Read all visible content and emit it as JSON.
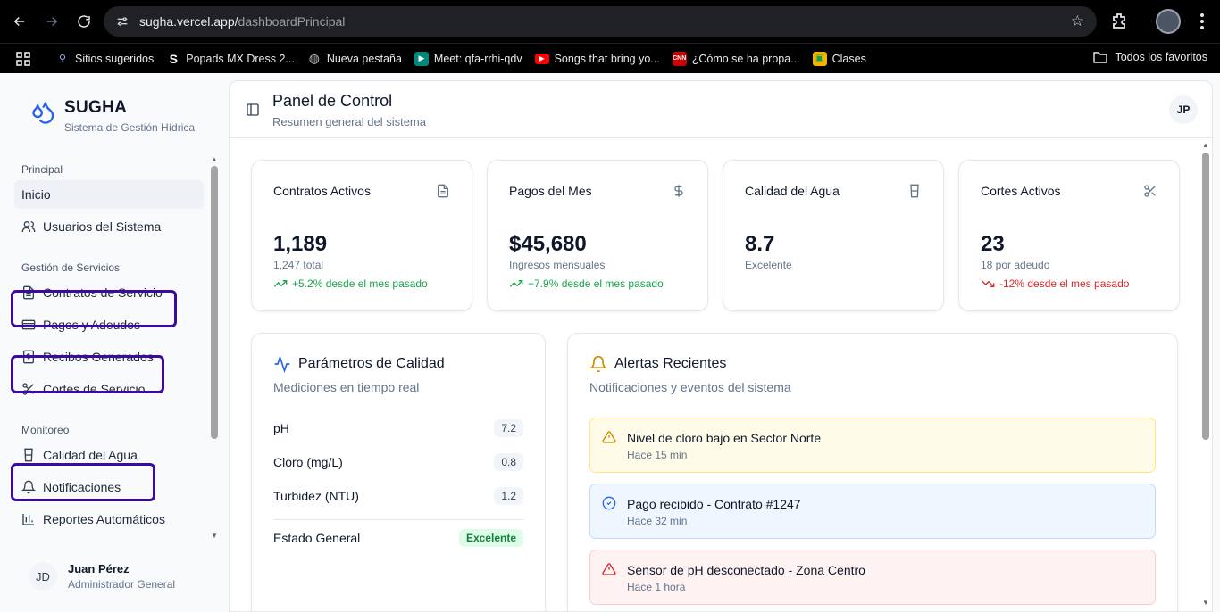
{
  "browser": {
    "url_host": "sugha.vercel.app/",
    "url_path": "dashboardPrincipal",
    "bookmarks": [
      {
        "label": "Sitios sugeridos",
        "icon": "search-icon",
        "color": "#8ab4f8"
      },
      {
        "label": "Popads MX Dress 2...",
        "icon": "s-logo-icon",
        "color": "#ffffff"
      },
      {
        "label": "Nueva pestaña",
        "icon": "globe-icon",
        "color": "#bdc1c6"
      },
      {
        "label": "Meet: qfa-rrhi-qdv",
        "icon": "meet-icon",
        "color": "#00897b"
      },
      {
        "label": "Songs that bring yo...",
        "icon": "youtube-icon",
        "color": "#ff0000"
      },
      {
        "label": "¿Cómo se ha propa...",
        "icon": "cnn-icon",
        "color": "#cc0000"
      },
      {
        "label": "Clases",
        "icon": "classroom-icon",
        "color": "#f4b400"
      }
    ],
    "all_bookmarks": "Todos los favoritos"
  },
  "brand": {
    "name": "SUGHA",
    "subtitle": "Sistema de Gestión Hídrica",
    "color": "#2563eb"
  },
  "sidebar": {
    "groups": [
      {
        "label": "Principal",
        "items": [
          {
            "label": "Inicio",
            "icon": "home-icon",
            "active": true
          },
          {
            "label": "Usuarios del Sistema",
            "icon": "users-icon"
          }
        ]
      },
      {
        "label": "Gestión de Servicios",
        "items": [
          {
            "label": "Contratos de Servicio",
            "icon": "file-text-icon"
          },
          {
            "label": "Pagos y Adeudos",
            "icon": "credit-card-icon"
          },
          {
            "label": "Recibos Generados",
            "icon": "receipt-icon"
          },
          {
            "label": "Cortes de Servicio",
            "icon": "scissors-icon"
          }
        ]
      },
      {
        "label": "Monitoreo",
        "items": [
          {
            "label": "Calidad del Agua",
            "icon": "glass-icon"
          },
          {
            "label": "Notificaciones",
            "icon": "bell-icon"
          },
          {
            "label": "Reportes Automáticos",
            "icon": "chart-icon"
          }
        ]
      }
    ],
    "user": {
      "initials": "JD",
      "name": "Juan Pérez",
      "role": "Administrador General"
    }
  },
  "header": {
    "title": "Panel de Control",
    "subtitle": "Resumen general del sistema",
    "avatar_initials": "JP"
  },
  "stats": [
    {
      "title": "Contratos Activos",
      "icon": "file-text-icon",
      "value": "1,189",
      "sub": "1,247 total",
      "trend": "+5.2% desde el mes pasado",
      "direction": "up"
    },
    {
      "title": "Pagos del Mes",
      "icon": "dollar-icon",
      "value": "$45,680",
      "sub": "Ingresos mensuales",
      "trend": "+7.9% desde el mes pasado",
      "direction": "up"
    },
    {
      "title": "Calidad del Agua",
      "icon": "glass-icon",
      "value": "8.7",
      "sub": "Excelente",
      "trend": "",
      "direction": "none"
    },
    {
      "title": "Cortes Activos",
      "icon": "scissors-icon",
      "value": "23",
      "sub": "18 por adeudo",
      "trend": "-12% desde el mes pasado",
      "direction": "down"
    }
  ],
  "quality": {
    "title": "Parámetros de Calidad",
    "subtitle": "Mediciones en tiempo real",
    "params": [
      {
        "label": "pH",
        "value": "7.2"
      },
      {
        "label": "Cloro (mg/L)",
        "value": "0.8"
      },
      {
        "label": "Turbidez (NTU)",
        "value": "1.2"
      }
    ],
    "overall_label": "Estado General",
    "overall_value": "Excelente"
  },
  "alerts": {
    "title": "Alertas Recientes",
    "subtitle": "Notificaciones y eventos del sistema",
    "items": [
      {
        "title": "Nivel de cloro bajo en Sector Norte",
        "time": "Hace 15 min",
        "type": "warning"
      },
      {
        "title": "Pago recibido - Contrato #1247",
        "time": "Hace 32 min",
        "type": "info"
      },
      {
        "title": "Sensor de pH desconectado - Zona Centro",
        "time": "Hace 1 hora",
        "type": "error"
      }
    ]
  },
  "colors": {
    "accent": "#2563eb",
    "success": "#16a34a",
    "danger": "#dc2626",
    "annotation": "#3b0a9e"
  }
}
